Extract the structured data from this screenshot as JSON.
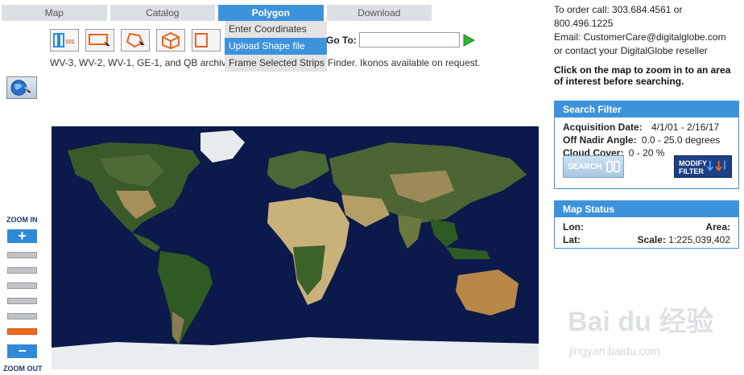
{
  "nav": {
    "tabs": [
      {
        "label": "Map"
      },
      {
        "label": "Catalog"
      },
      {
        "label": "Polygon"
      },
      {
        "label": "Download"
      }
    ]
  },
  "polygon_menu": {
    "items": [
      {
        "label": "Enter Coordinates"
      },
      {
        "label": "Upload Shape file"
      },
      {
        "label": "Frame Selected Strips"
      }
    ]
  },
  "toolbar": {
    "icons": [
      "id-search-icon",
      "rectangle-select-icon",
      "polygon-draw-icon",
      "cube-icon",
      "partial-icon"
    ],
    "goto_label": "Go To:",
    "goto_value": ""
  },
  "notice": {
    "left": "WV-3, WV-2, WV-1, GE-1, and QB archive",
    "right": "Finder. Ikonos available on request."
  },
  "zoom": {
    "in_label": "ZOOM IN",
    "out_label": "ZOOM OUT",
    "level": 6
  },
  "contact": {
    "line1": "To order call: 303.684.4561 or 800.496.1225",
    "line2": "Email: CustomerCare@digitalglobe.com",
    "line3": "or contact your DigitalGlobe reseller"
  },
  "instruction": "Click on the map to zoom in to an area of interest before searching.",
  "search_filter": {
    "title": "Search Filter",
    "acq_key": "Acquisition Date:",
    "acq_val": "4/1/01 - 2/16/17",
    "nadir_key": "Off Nadir Angle:",
    "nadir_val": "0.0 - 25.0 degrees",
    "cloud_key": "Cloud Cover:",
    "cloud_val": "0 - 20 %",
    "search_label": "SEARCH",
    "modify_label_1": "MODIFY",
    "modify_label_2": "FILTER"
  },
  "map_status": {
    "title": "Map Status",
    "lon_key": "Lon:",
    "lon_val": "",
    "area_key": "Area:",
    "area_val": "",
    "lat_key": "Lat:",
    "lat_val": "",
    "scale_key": "Scale:",
    "scale_val": "1:225,039,402"
  },
  "watermark": {
    "main": "Bai du 经验",
    "sub": "jingyan.baidu.com"
  },
  "colors": {
    "accent": "#3d93db",
    "ocean": "#0b1a4a",
    "zoom_active": "#f26a1b"
  }
}
